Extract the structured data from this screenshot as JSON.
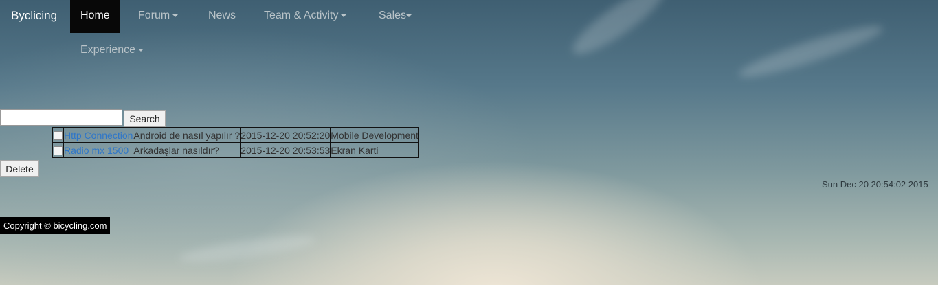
{
  "navbar": {
    "brand": "Byclicing",
    "items": [
      {
        "label": "Home"
      },
      {
        "label": "Forum"
      },
      {
        "label": "News"
      },
      {
        "label": "Team & Activity"
      },
      {
        "label": "Sales"
      },
      {
        "label": "Experience"
      }
    ]
  },
  "search": {
    "value": "",
    "button_label": "Search"
  },
  "posts": {
    "rows": [
      {
        "title": "Http Connection",
        "description": "Android de nasıl yapılır ?",
        "date": "2015-12-20 20:52:20",
        "category": "Mobile Development"
      },
      {
        "title": "Radio mx 1500",
        "description": "Arkadaşlar nasıldır?",
        "date": "2015-12-20 20:53:53",
        "category": "Ekran Karti"
      }
    ]
  },
  "delete_label": "Delete",
  "clock": "Sun Dec 20 20:54:02 2015",
  "footer": "Copyright © bicycling.com",
  "colors": {
    "link": "#2e76c9",
    "navbar_active_bg": "#080808"
  }
}
